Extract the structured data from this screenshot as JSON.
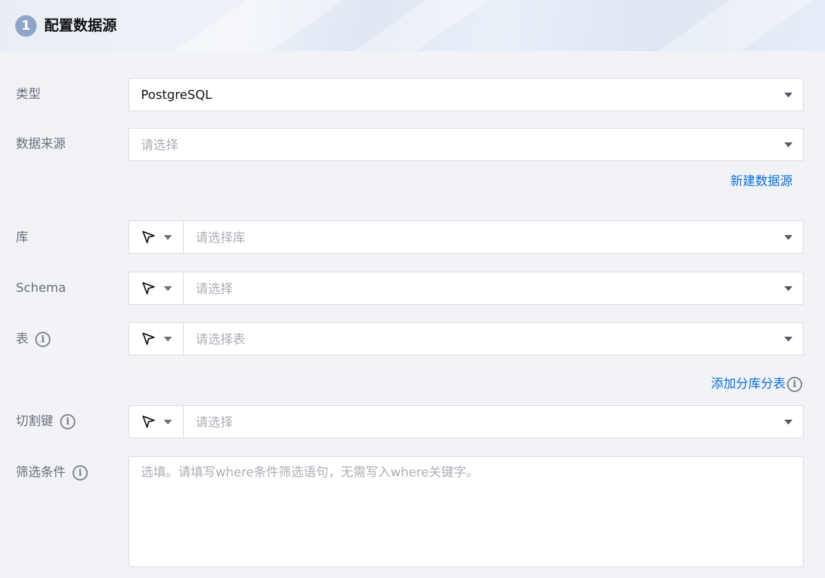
{
  "section": {
    "step": "1",
    "title": "配置数据源"
  },
  "fields": {
    "type": {
      "label": "类型",
      "value": "PostgreSQL"
    },
    "source": {
      "label": "数据来源",
      "placeholder": "请选择",
      "link": "新建数据源"
    },
    "database": {
      "label": "库",
      "placeholder": "请选择库"
    },
    "schema": {
      "label": "Schema",
      "placeholder": "请选择"
    },
    "table": {
      "label": "表",
      "placeholder": "请选择表",
      "link": "添加分库分表"
    },
    "split_key": {
      "label": "切割键",
      "placeholder": "请选择"
    },
    "filter": {
      "label": "筛选条件",
      "placeholder": "选填。请填写where条件筛选语句，无需写入where关键字。"
    }
  },
  "icons": {
    "mode": "cursor-arrow-icon",
    "caret": "caret-down-icon",
    "info": "info-icon"
  },
  "colors": {
    "link": "#0a6fd6",
    "badge": "#8ea5c9"
  }
}
